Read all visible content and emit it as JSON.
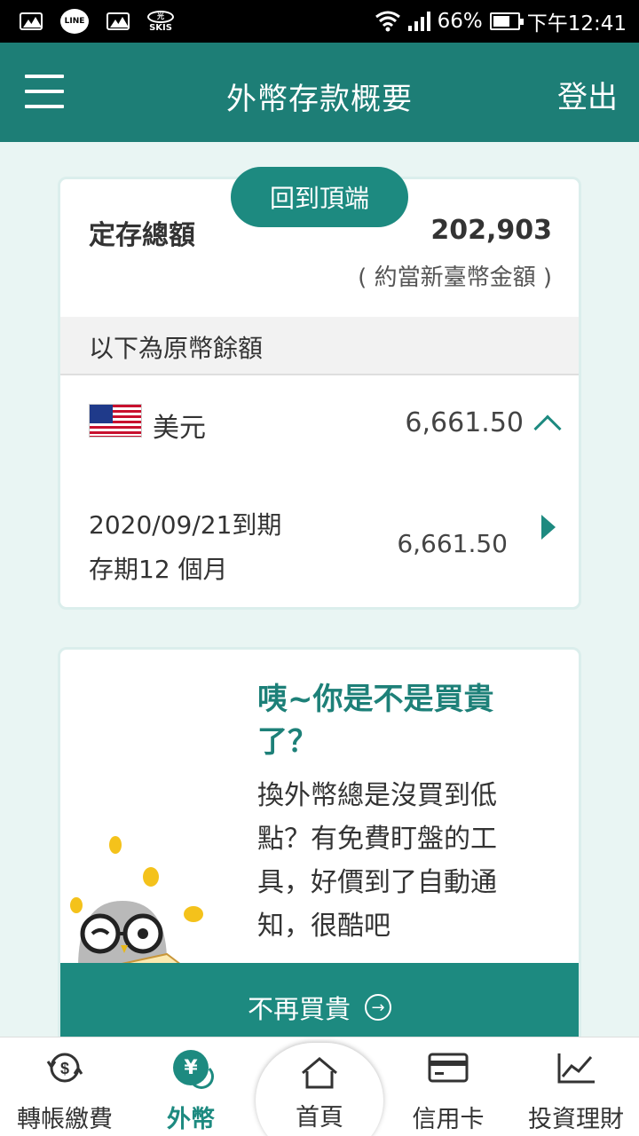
{
  "status_bar": {
    "signal_text": "66%",
    "time": "下午12:41",
    "notification_icons": [
      "gallery-icon",
      "line-icon",
      "gallery-icon",
      "skis-icon"
    ],
    "line_label": "LINE",
    "skis_label": "SKIS",
    "skis_badge": "光"
  },
  "header": {
    "title": "外幣存款概要",
    "logout": "登出",
    "background": "#1d7e76"
  },
  "summary": {
    "back_to_top": "回到頂端",
    "total_label": "定存總額",
    "total_value": "202,903",
    "total_note": "( 約當新臺幣金額 )",
    "subheader": "以下為原幣餘額"
  },
  "currency_row": {
    "flag": "us-flag-icon",
    "name": "美元",
    "amount": "6,661.50",
    "expanded": true
  },
  "deposit": {
    "maturity": "2020/09/21到期",
    "term": "存期12 個月",
    "amount": "6,661.50"
  },
  "promo": {
    "title": "咦~你是不是買貴了？",
    "body": "換外幣總是沒買到低點？有免費盯盤的工具，好價到了自動通知，很酷吧",
    "cta": "不再買貴"
  },
  "bottom_nav": {
    "items": [
      {
        "label": "轉帳繳費",
        "icon": "transfer-icon",
        "active": false
      },
      {
        "label": "外幣",
        "icon": "yen-icon",
        "active": true
      },
      {
        "label": "首頁",
        "icon": "home-icon",
        "active": false
      },
      {
        "label": "信用卡",
        "icon": "credit-card-icon",
        "active": false
      },
      {
        "label": "投資理財",
        "icon": "chart-icon",
        "active": false
      }
    ]
  },
  "colors": {
    "accent": "#1d8a80",
    "page_background": "#e9f5f3",
    "status_bar": "#000000"
  }
}
